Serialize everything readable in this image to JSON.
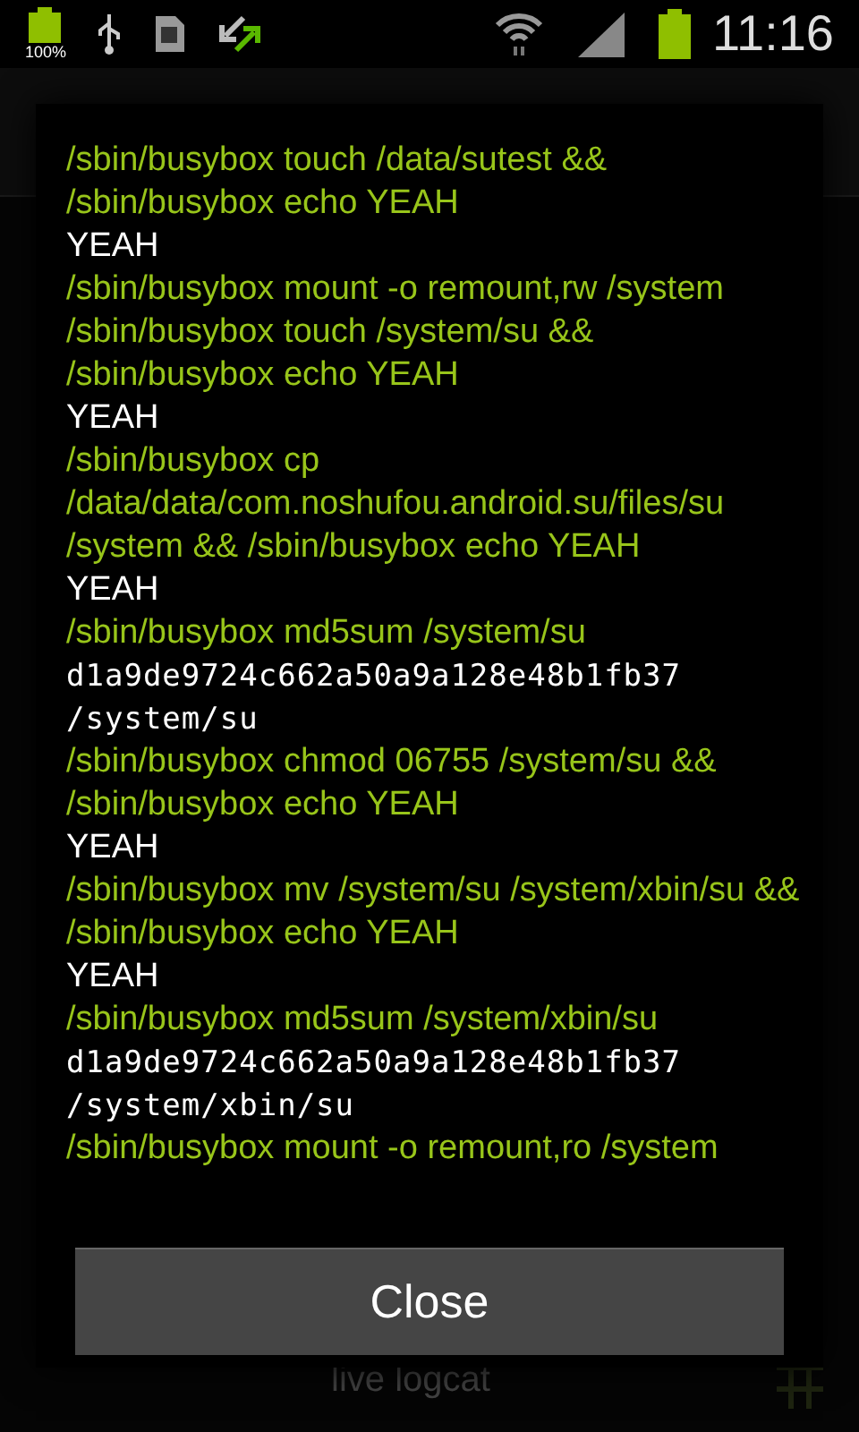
{
  "status_bar": {
    "battery_label": "100%",
    "time": "11:16"
  },
  "log": [
    {
      "kind": "command",
      "text": "/sbin/busybox touch /data/sutest && /sbin/busybox echo YEAH"
    },
    {
      "kind": "output",
      "text": "YEAH"
    },
    {
      "kind": "command",
      "text": "/sbin/busybox mount -o remount,rw /system"
    },
    {
      "kind": "command",
      "text": "/sbin/busybox touch /system/su && /sbin/busybox echo YEAH"
    },
    {
      "kind": "output",
      "text": "YEAH"
    },
    {
      "kind": "command",
      "text": "/sbin/busybox cp /data/data/com.noshufou.android.su/files/su /system && /sbin/busybox echo YEAH"
    },
    {
      "kind": "output",
      "text": "YEAH"
    },
    {
      "kind": "command",
      "text": "/sbin/busybox md5sum /system/su"
    },
    {
      "kind": "hash",
      "text": "d1a9de9724c662a50a9a128e48b1fb37 /system/su"
    },
    {
      "kind": "command",
      "text": "/sbin/busybox chmod 06755 /system/su && /sbin/busybox echo YEAH"
    },
    {
      "kind": "output",
      "text": "YEAH"
    },
    {
      "kind": "command",
      "text": "/sbin/busybox mv /system/su /system/xbin/su && /sbin/busybox echo YEAH"
    },
    {
      "kind": "output",
      "text": "YEAH"
    },
    {
      "kind": "command",
      "text": "/sbin/busybox md5sum /system/xbin/su"
    },
    {
      "kind": "hash",
      "text": "d1a9de9724c662a50a9a128e48b1fb37 /system/xbin/su"
    },
    {
      "kind": "command",
      "text": "/sbin/busybox mount -o remount,ro /system"
    }
  ],
  "close_button": "Close",
  "background_item": "live logcat"
}
